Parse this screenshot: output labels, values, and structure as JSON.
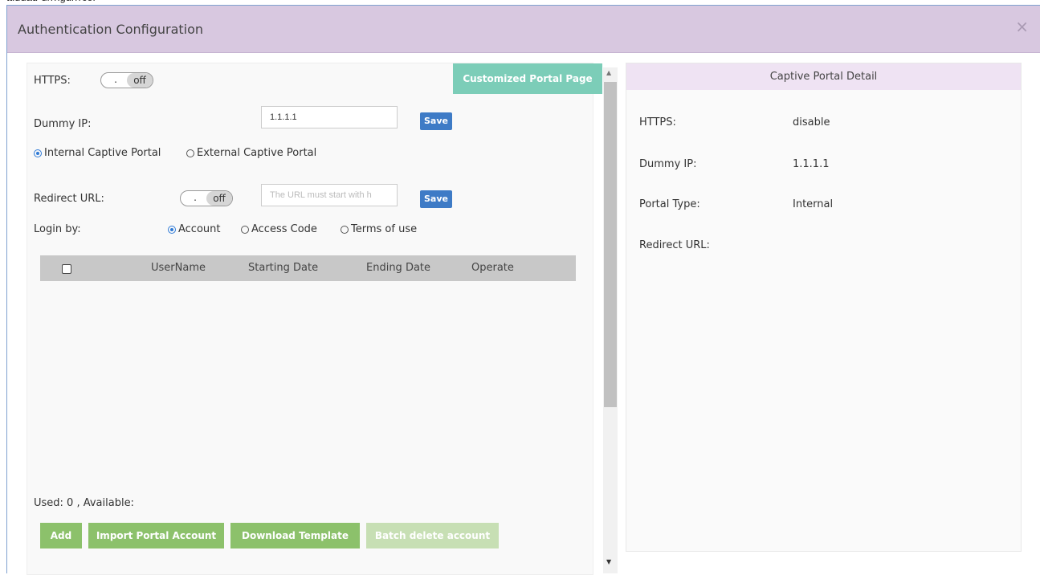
{
  "browser_strip_text": "ttiudad-urrrigurrrcor",
  "dialog": {
    "title": "Authentication Configuration",
    "close": "×"
  },
  "left": {
    "https_label": "HTTPS:",
    "https_toggle": {
      "knob": ".",
      "state": "off"
    },
    "customized_portal_btn": "Customized Portal Page",
    "dummy_ip_label": "Dummy IP:",
    "dummy_ip_value": "1.1.1.1",
    "save_label": "Save",
    "portal_options": [
      {
        "label": "Internal Captive Portal",
        "checked": true
      },
      {
        "label": "External Captive Portal",
        "checked": false
      }
    ],
    "redirect_label": "Redirect URL:",
    "redirect_toggle": {
      "knob": ".",
      "state": "off"
    },
    "redirect_placeholder": "The URL must start with h",
    "login_label": "Login by:",
    "login_options": [
      {
        "label": "Account",
        "checked": true
      },
      {
        "label": "Access Code",
        "checked": false
      },
      {
        "label": "Terms of use",
        "checked": false
      }
    ],
    "table_headers": [
      "UserName",
      "Starting Date",
      "Ending Date",
      "Operate"
    ],
    "usage": "Used: 0 , Available:",
    "bottom_buttons": [
      "Add",
      "Import Portal Account",
      "Download Template",
      "Batch delete account"
    ]
  },
  "right": {
    "title": "Captive Portal Detail",
    "rows": [
      {
        "label": "HTTPS:",
        "value": "disable"
      },
      {
        "label": "Dummy IP:",
        "value": "1.1.1.1"
      },
      {
        "label": "Portal Type:",
        "value": "Internal"
      },
      {
        "label": "Redirect URL:",
        "value": ""
      }
    ]
  },
  "colors": {
    "header_bg": "#d8c8e0",
    "teal_button": "#7ccdb8",
    "save_button": "#3e7bc6",
    "green_button": "#8cc16b",
    "radio_accent": "#2f7ad6"
  },
  "icons": {
    "close": "close-icon",
    "scroll_up": "scroll-up-arrow-icon",
    "scroll_down": "scroll-down-arrow-icon"
  }
}
